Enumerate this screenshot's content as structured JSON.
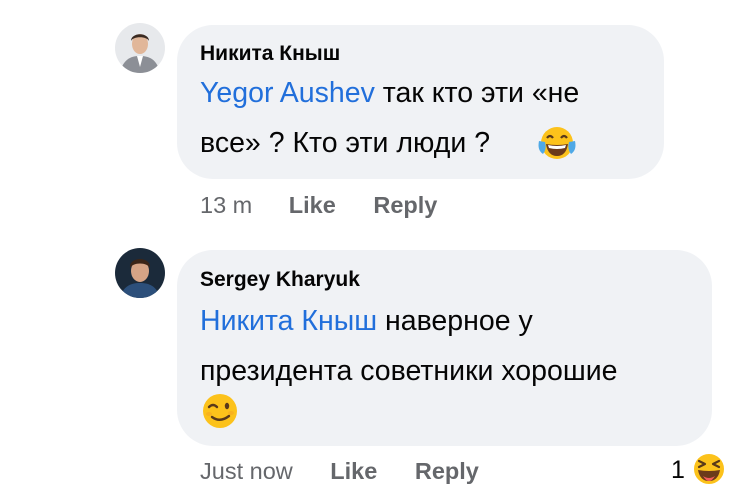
{
  "comments": [
    {
      "author": "Никита Кныш",
      "mention": "Yegor Aushev",
      "line1_rest": " так кто эти «не",
      "line2": "все» ? Кто эти люди ?",
      "emoji_icon": "tears-of-joy-emoji",
      "time": "13 m",
      "like": "Like",
      "reply": "Reply"
    },
    {
      "author": "Sergey Kharyuk",
      "mention": "Никита Кныш",
      "line1_rest": " наверное у",
      "line2": "президента советники хорошие",
      "emoji_icon": "winking-face-emoji",
      "time": "Just now",
      "like": "Like",
      "reply": "Reply",
      "reaction_count": "1",
      "reaction_icon": "laughing-reaction-icon"
    }
  ],
  "colors": {
    "bubble": "#f0f2f5",
    "mention": "#216fdb",
    "meta": "#65676b",
    "text": "#050505"
  }
}
